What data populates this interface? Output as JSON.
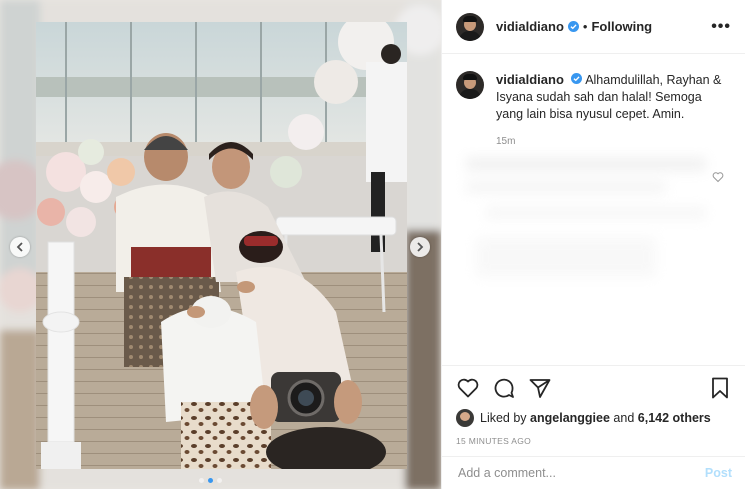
{
  "post": {
    "username": "vidialdiano",
    "follow_status": "Following",
    "separator": "•",
    "more_label": "•••"
  },
  "caption": {
    "username": "vidialdiano",
    "text": "Alhamdulillah, Rayhan & Isyana sudah sah dan halal! Semoga yang lain bisa nyusul cepet. Amin.",
    "time": "15m"
  },
  "likes": {
    "prefix": "Liked by",
    "user": "angelanggiee",
    "middle": "and",
    "others": "6,142 others"
  },
  "timestamp": "15 MINUTES AGO",
  "comment_box": {
    "placeholder": "Add a comment...",
    "post_label": "Post"
  },
  "carousel": {
    "total": 3,
    "active_index": 1
  },
  "colors": {
    "verified": "#3897f0",
    "post_disabled": "#b2dffc",
    "dot_active": "#3897f0"
  },
  "icons": [
    "heart-icon",
    "comment-icon",
    "share-icon",
    "bookmark-icon",
    "verified-badge-icon",
    "chevron-left-icon",
    "chevron-right-icon"
  ]
}
